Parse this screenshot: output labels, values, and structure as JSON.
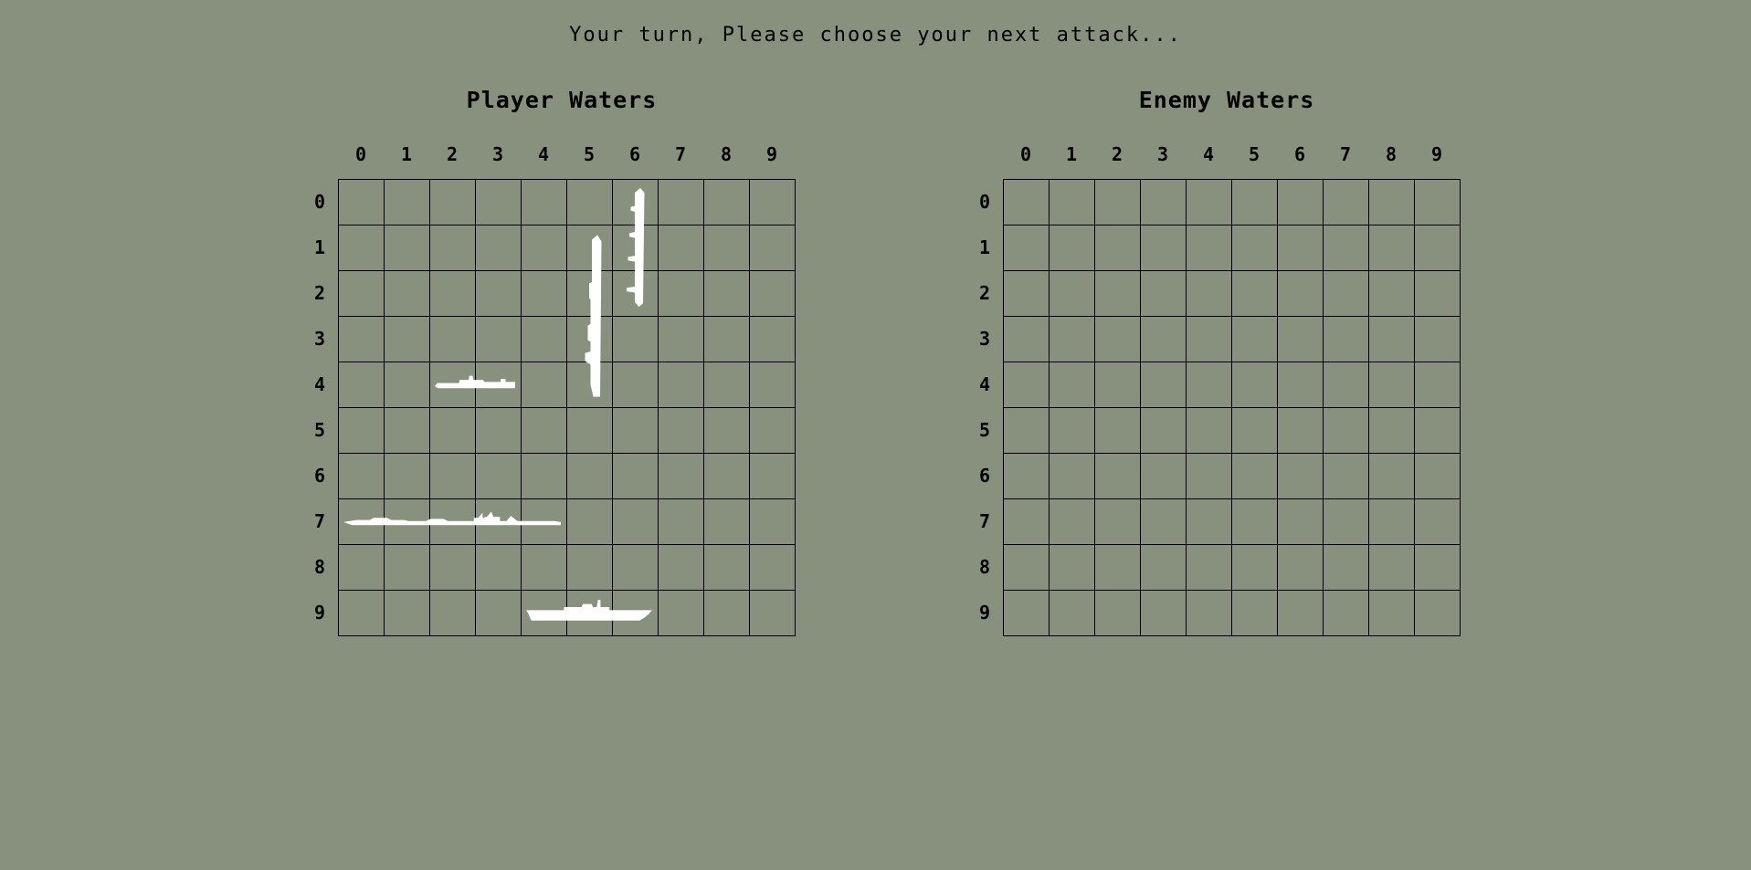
{
  "status_message": "Your turn, Please choose your next attack...",
  "colors": {
    "background": "#87917d",
    "grid_line": "#000000",
    "ship": "#ffffff"
  },
  "player_board": {
    "title": "Player Waters",
    "columns": [
      "0",
      "1",
      "2",
      "3",
      "4",
      "5",
      "6",
      "7",
      "8",
      "9"
    ],
    "rows": [
      "0",
      "1",
      "2",
      "3",
      "4",
      "5",
      "6",
      "7",
      "8",
      "9"
    ],
    "ships": [
      {
        "name": "carrier",
        "orientation": "horizontal",
        "row": 7,
        "col": 0,
        "length": 5
      },
      {
        "name": "battleship",
        "orientation": "vertical",
        "row": 1,
        "col": 5,
        "length": 4
      },
      {
        "name": "cruiser",
        "orientation": "vertical",
        "row": 0,
        "col": 6,
        "length": 3
      },
      {
        "name": "submarine",
        "orientation": "horizontal",
        "row": 9,
        "col": 4,
        "length": 3
      },
      {
        "name": "destroyer",
        "orientation": "horizontal",
        "row": 4,
        "col": 2,
        "length": 2
      }
    ]
  },
  "enemy_board": {
    "title": "Enemy Waters",
    "columns": [
      "0",
      "1",
      "2",
      "3",
      "4",
      "5",
      "6",
      "7",
      "8",
      "9"
    ],
    "rows": [
      "0",
      "1",
      "2",
      "3",
      "4",
      "5",
      "6",
      "7",
      "8",
      "9"
    ]
  }
}
